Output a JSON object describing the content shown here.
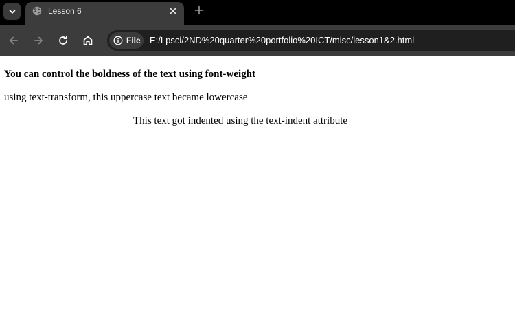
{
  "browser": {
    "tab": {
      "title": "Lesson 6"
    },
    "omnibox": {
      "chip_label": "File",
      "url": "E:/Lpsci/2ND%20quarter%20portfolio%20ICT/misc/lesson1&2.html"
    },
    "icons": {
      "tab_search": "chevron-down-icon",
      "favicon": "globe-icon",
      "close": "close-icon",
      "new_tab": "plus-icon",
      "back": "arrow-left-icon",
      "forward": "arrow-right-icon",
      "reload": "reload-icon",
      "home": "home-icon",
      "info": "info-icon"
    },
    "colors": {
      "tabbar": "#000000",
      "toolbar": "#3c3c3c",
      "omnibox": "#1f1f1f"
    }
  },
  "page": {
    "paragraph_1": "You can control the boldness of the text using font-weight",
    "paragraph_2": "using text-transform, this uppercase text became lowercase",
    "paragraph_3": "This text got indented using the text-indent attribute"
  }
}
